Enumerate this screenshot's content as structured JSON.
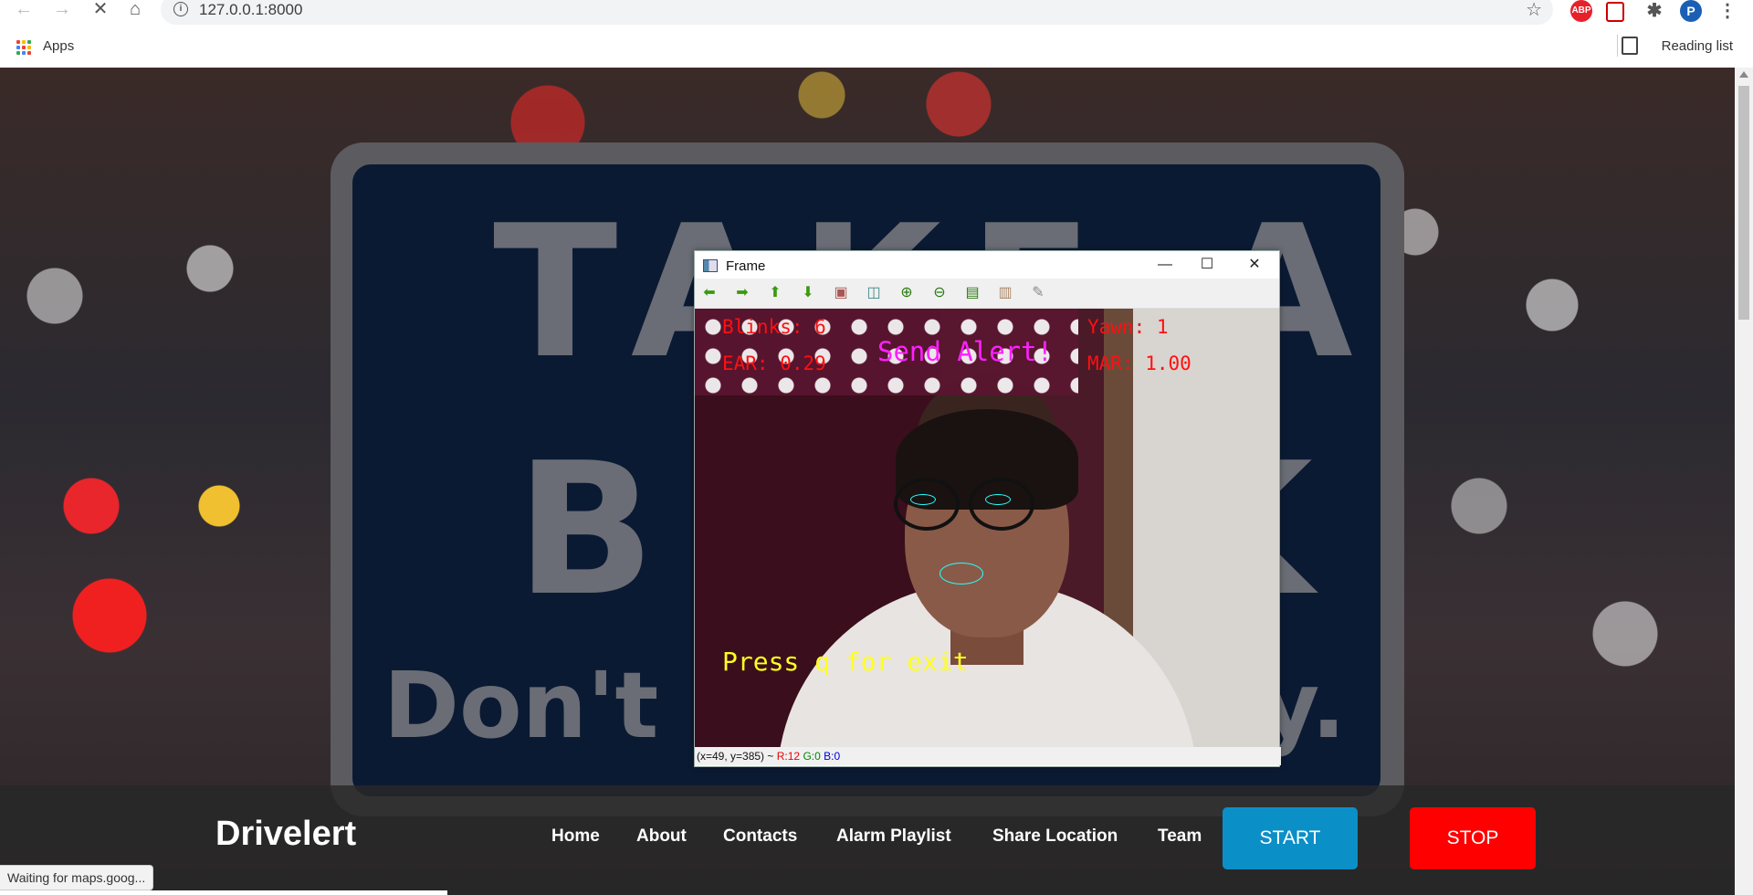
{
  "browser": {
    "url": "127.0.0.1:8000",
    "info_glyph": "i",
    "bookmarks": {
      "apps_label": "Apps",
      "reading_list_label": "Reading list"
    },
    "extensions": {
      "abp": "ABP",
      "profile": "P"
    },
    "status_text": "Waiting for maps.goog..."
  },
  "page": {
    "sign": {
      "line1": "TAKE A",
      "line2": "BREAK",
      "line3": "Don't drive sleepy."
    },
    "navbar": {
      "brand": "Drivelert",
      "links": [
        "Home",
        "About",
        "Contacts",
        "Alarm Playlist",
        "Share Location",
        "Team"
      ],
      "start_label": "START",
      "stop_label": "STOP"
    }
  },
  "frame_window": {
    "title": "Frame",
    "overlay": {
      "blinks": "Blinks: 6",
      "ear": "EAR: 0.29",
      "alert": "Send Alert!",
      "yawn": "Yawn: 1",
      "mar": "MAR: 1.00",
      "exit_hint": "Press q for exit"
    },
    "status": {
      "coords": "(x=49, y=385) ~",
      "r": "R:12",
      "g": "G:0",
      "b": "B:0"
    }
  },
  "colors": {
    "start": "#0b8fc7",
    "stop": "#ff0000",
    "overlay_red": "#ff1010",
    "overlay_magenta": "#ff20ff",
    "overlay_yellow": "#ffff20",
    "landmarks": "#22ffff"
  }
}
